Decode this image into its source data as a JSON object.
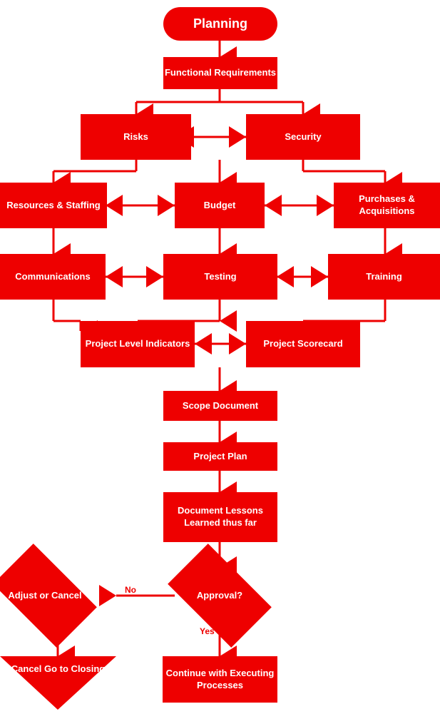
{
  "nodes": {
    "planning": {
      "label": "Planning"
    },
    "functional_requirements": {
      "label": "Functional Requirements"
    },
    "risks": {
      "label": "Risks"
    },
    "security": {
      "label": "Security"
    },
    "resources_staffing": {
      "label": "Resources & Staffing"
    },
    "budget": {
      "label": "Budget"
    },
    "purchases_acquisitions": {
      "label": "Purchases & Acquisitions"
    },
    "communications": {
      "label": "Communications"
    },
    "testing": {
      "label": "Testing"
    },
    "training": {
      "label": "Training"
    },
    "project_level_indicators": {
      "label": "Project Level Indicators"
    },
    "project_scorecard": {
      "label": "Project Scorecard"
    },
    "scope_document": {
      "label": "Scope Document"
    },
    "project_plan": {
      "label": "Project Plan"
    },
    "document_lessons": {
      "label": "Document Lessons Learned thus far"
    },
    "approval": {
      "label": "Approval?"
    },
    "adjust_cancel": {
      "label": "Adjust or Cancel"
    },
    "cancel_closing": {
      "label": "Cancel Go to Closing"
    },
    "continue_executing": {
      "label": "Continue with Executing Processes"
    },
    "no_label": {
      "label": "No"
    },
    "yes_label": {
      "label": "Yes"
    }
  }
}
